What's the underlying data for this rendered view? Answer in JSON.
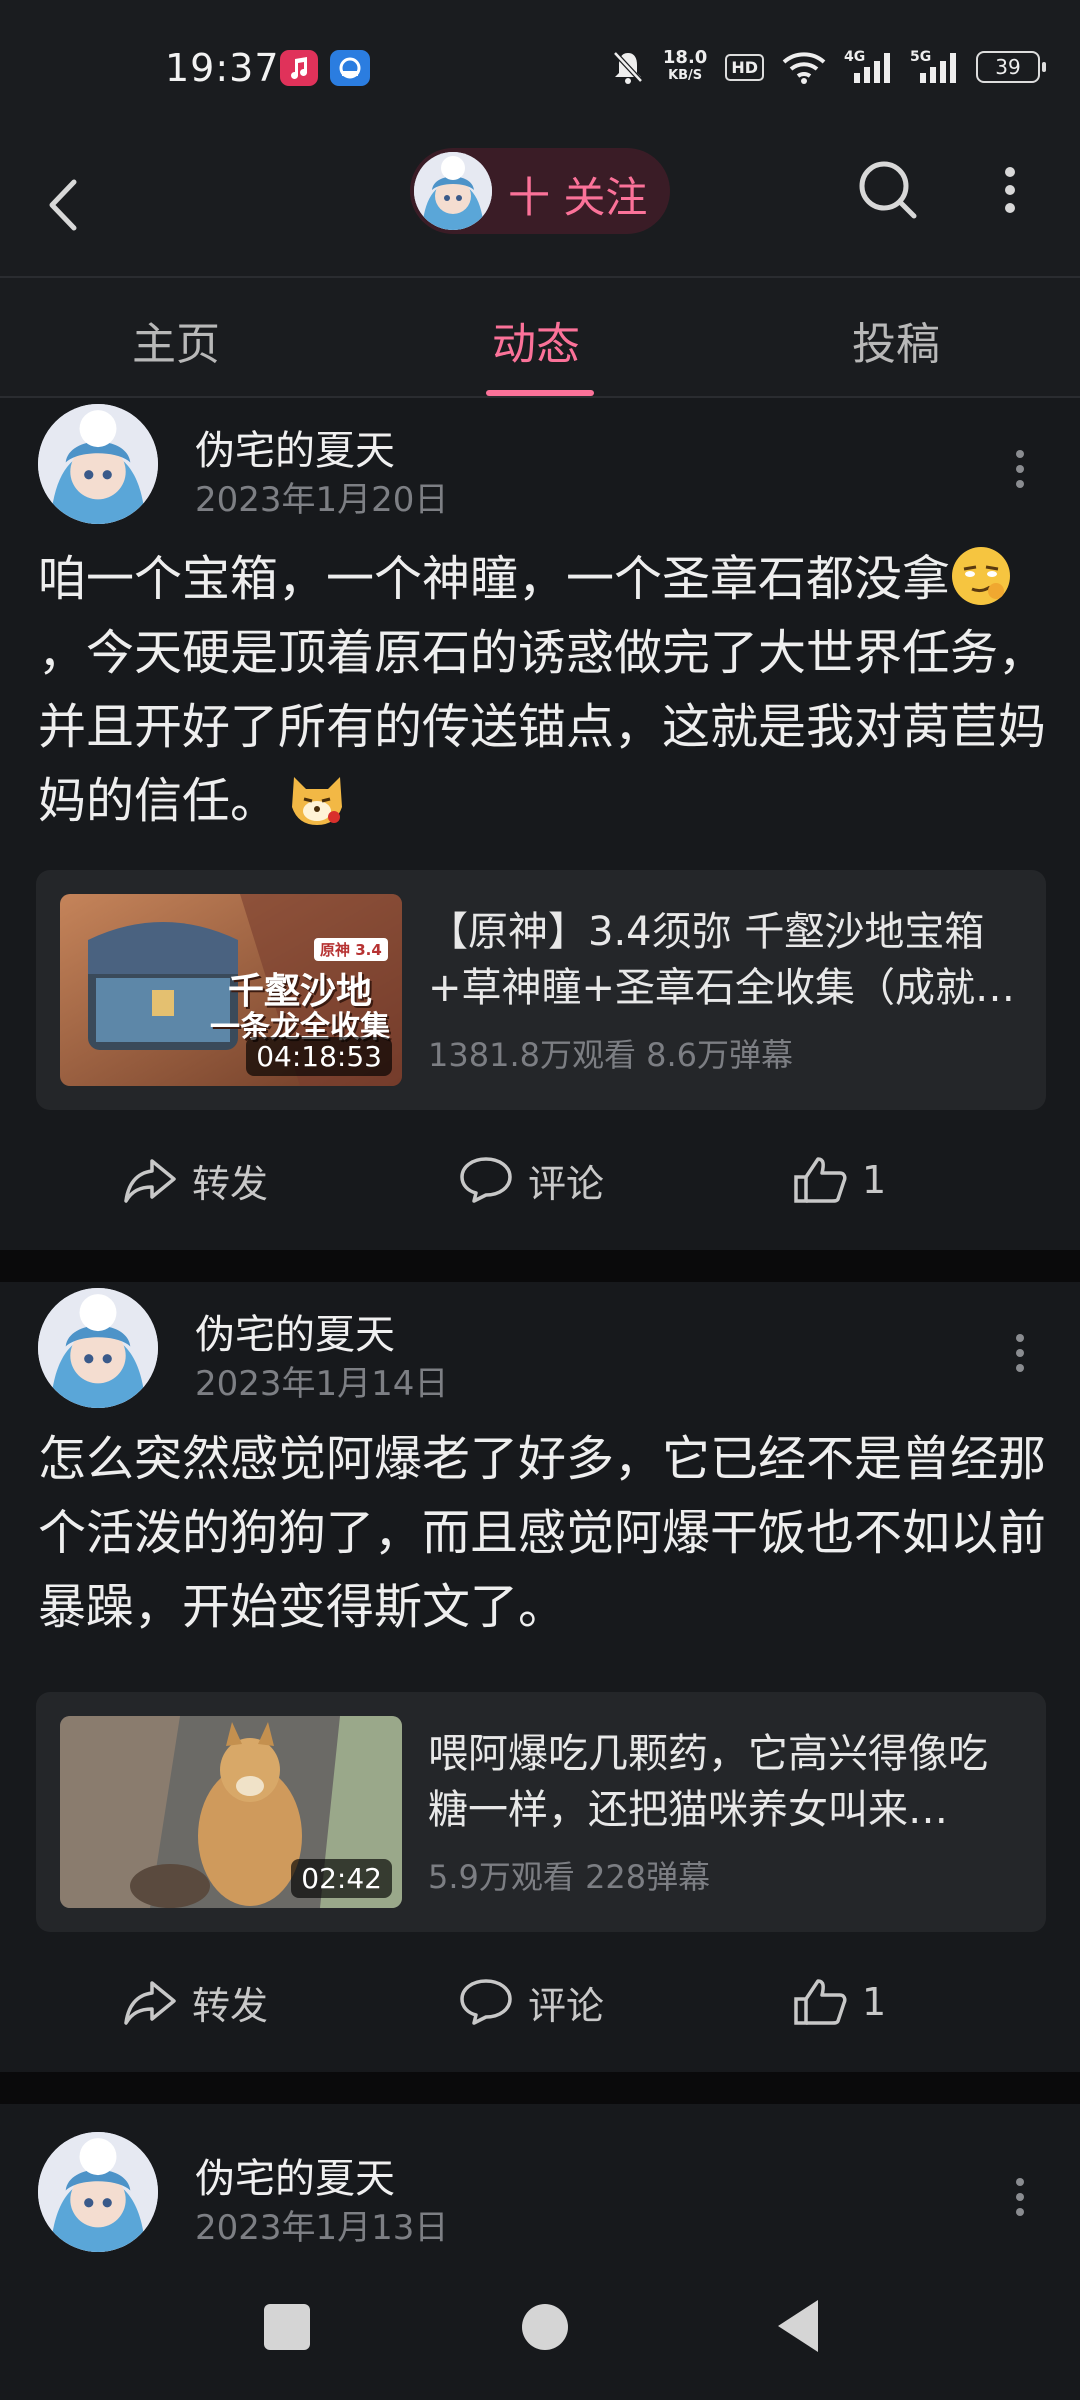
{
  "status_bar": {
    "time": "19:37",
    "net_speed_value": "18.0",
    "net_speed_unit": "KB/S",
    "hd_label": "HD",
    "signal1_label": "4G",
    "signal2_label": "5G",
    "battery": "39",
    "icons": [
      "music-app-icon",
      "cloud-app-icon",
      "mute-icon",
      "wifi-icon",
      "signal-icon",
      "battery-icon"
    ]
  },
  "header": {
    "follow_label": "十 关注",
    "icons": [
      "back-icon",
      "search-icon",
      "more-icon"
    ]
  },
  "tabs": [
    {
      "label": "主页",
      "active": false
    },
    {
      "label": "动态",
      "active": true
    },
    {
      "label": "投稿",
      "active": false
    }
  ],
  "posts": [
    {
      "author": "伪宅的夏天",
      "date": "2023年1月20日",
      "text_part1": "咱一个宝箱，一个神瞳，一个圣章石都没拿",
      "text_part2": "，今天硬是顶着原石的诱惑做完了大世界任务，并且开好了所有的传送锚点，这就是我对莴苣妈妈的信任。",
      "video": {
        "thumb_tag": "原神 3.4",
        "thumb_title_line1": "千壑沙地",
        "thumb_title_line2": "一条龙全收集",
        "duration": "04:18:53",
        "title": "【原神】3.4须弥 千壑沙地宝箱+草神瞳+圣章石全收集（成就…",
        "stats": "1381.8万观看 8.6万弹幕"
      },
      "actions": {
        "share": "转发",
        "comment": "评论",
        "like": "1"
      }
    },
    {
      "author": "伪宅的夏天",
      "date": "2023年1月14日",
      "text": "怎么突然感觉阿爆老了好多，它已经不是曾经那个活泼的狗狗了，而且感觉阿爆干饭也不如以前暴躁，开始变得斯文了。",
      "video": {
        "duration": "02:42",
        "title": "喂阿爆吃几颗药，它高兴得像吃糖一样，还把猫咪养女叫来…",
        "stats": "5.9万观看 228弹幕"
      },
      "actions": {
        "share": "转发",
        "comment": "评论",
        "like": "1"
      }
    },
    {
      "author": "伪宅的夏天",
      "date": "2023年1月13日"
    }
  ],
  "colors": {
    "accent": "#fb7299",
    "background": "#17191c",
    "card": "#242629"
  }
}
